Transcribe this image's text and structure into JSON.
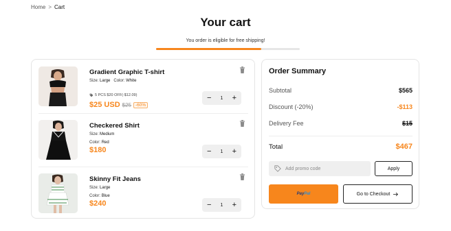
{
  "breadcrumb": {
    "home": "Home",
    "separator": ">",
    "current": "Cart"
  },
  "page": {
    "title": "Your cart"
  },
  "shipping": {
    "message": "You order is eligible for free shipping!",
    "progress": 0.73
  },
  "cart": {
    "items": [
      {
        "name": "Gradient Graphic T-shirt",
        "size_label": "Size:",
        "size": "Large",
        "color_label": "Color:",
        "color": "White",
        "promo": "5 PCS $20 OFF(-$12.09)",
        "price": "$25 USD",
        "old_price": "$25",
        "discount": "-60%",
        "quantity": "1",
        "minus": "−",
        "plus": "+"
      },
      {
        "name": "Checkered Shirt",
        "size_label": "Size:",
        "size": "Medium",
        "color_label": "Color:",
        "color": "Red",
        "price": "$180",
        "quantity": "1",
        "minus": "−",
        "plus": "+"
      },
      {
        "name": "Skinny Fit Jeans",
        "size_label": "Size:",
        "size": "Large",
        "color_label": "Color:",
        "color": "Blue",
        "price": "$240",
        "quantity": "1",
        "minus": "−",
        "plus": "+"
      }
    ]
  },
  "summary": {
    "title": "Order Summary",
    "subtotal_label": "Subtotal",
    "subtotal": "$565",
    "discount_label": "Discount (-20%)",
    "discount": "-$113",
    "delivery_label": "Delivery Fee",
    "delivery": "$15",
    "total_label": "Total",
    "total": "$467",
    "promo_placeholder": "Add promo code",
    "apply_label": "Apply",
    "paypal_part1": "Pay",
    "paypal_part2": "Pal",
    "checkout_label": "Go to Checkout"
  },
  "colors": {
    "accent": "#f7861c",
    "text": "#111111",
    "muted": "#555555"
  },
  "icons": [
    "chevron-right-icon",
    "trash-icon",
    "tag-icon",
    "arrow-right-icon"
  ]
}
